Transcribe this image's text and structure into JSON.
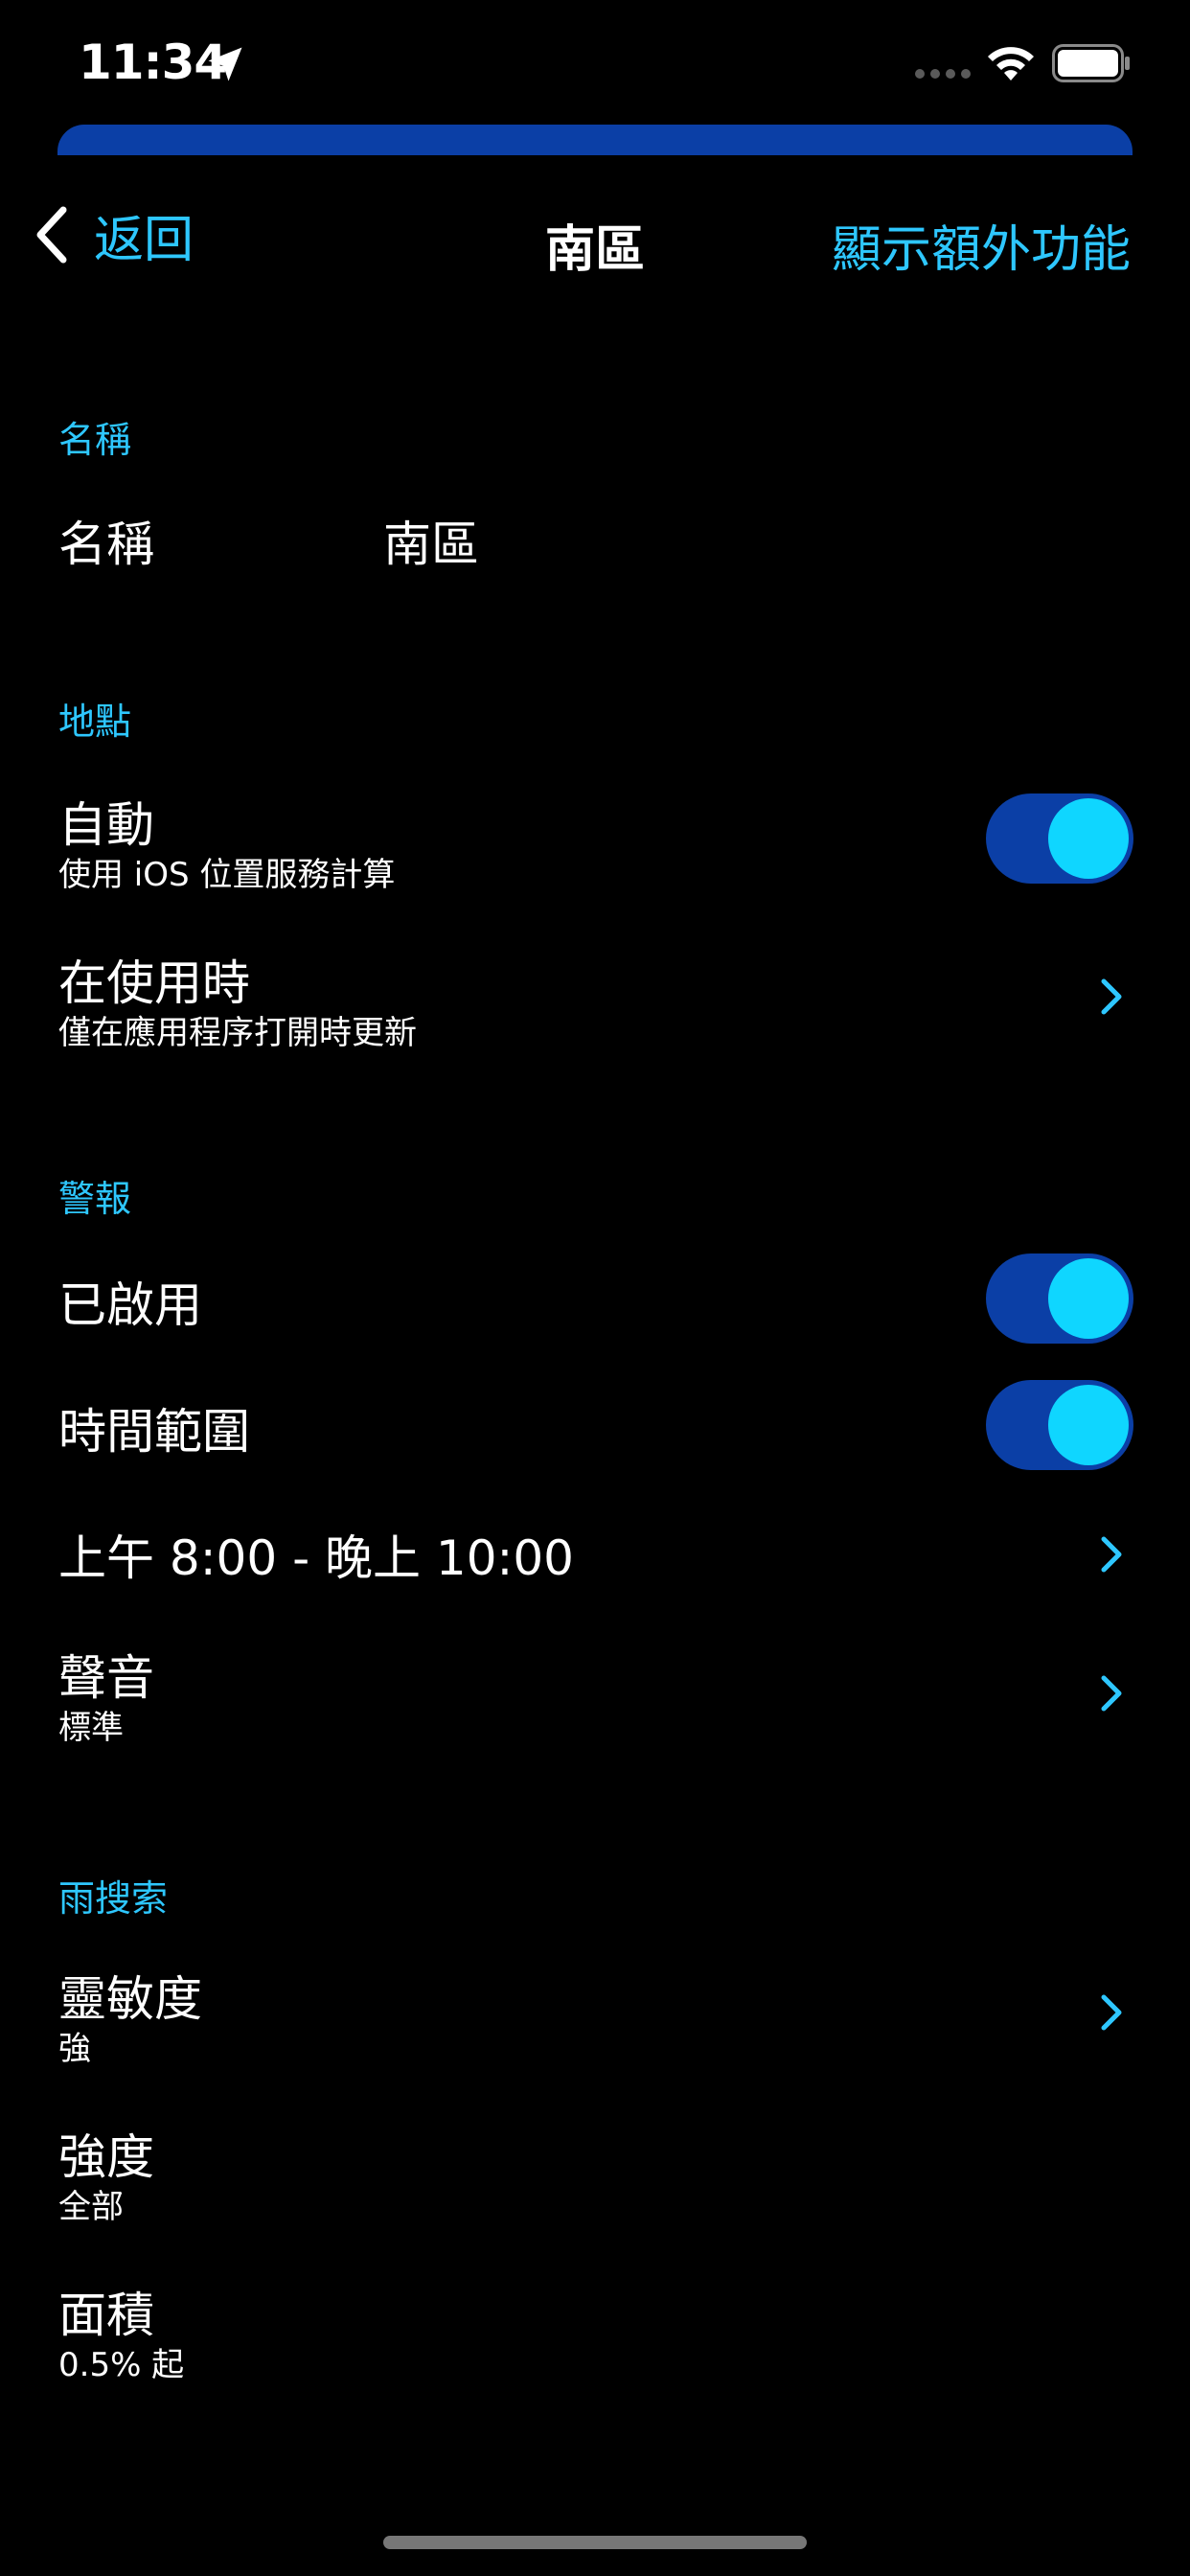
{
  "status_bar": {
    "time": "11:34"
  },
  "nav": {
    "back_label": "返回",
    "title": "南區",
    "right_action": "顯示額外功能"
  },
  "sections": {
    "name": {
      "header": "名稱",
      "row_title": "名稱",
      "row_value": "南區"
    },
    "location": {
      "header": "地點",
      "auto_title": "自動",
      "auto_sub": "使用 iOS 位置服務計算",
      "auto_enabled": true,
      "when_using_title": "在使用時",
      "when_using_sub": "僅在應用程序打開時更新"
    },
    "alerts": {
      "header": "警報",
      "enabled_title": "已啟用",
      "enabled_on": true,
      "time_range_title": "時間範圍",
      "time_range_on": true,
      "time_range_value": "上午 8:00 - 晚上 10:00",
      "sound_title": "聲音",
      "sound_sub": "標準"
    },
    "rain_search": {
      "header": "雨搜索",
      "sensitivity_title": "靈敏度",
      "sensitivity_sub": "強",
      "intensity_title": "強度",
      "intensity_sub": "全部",
      "area_title": "面積",
      "area_sub": "0.5% 起"
    }
  },
  "colors": {
    "accent": "#2ec7ff",
    "toggle_track": "#0b3fa6",
    "toggle_knob": "#0fd6ff",
    "background": "#000000"
  }
}
